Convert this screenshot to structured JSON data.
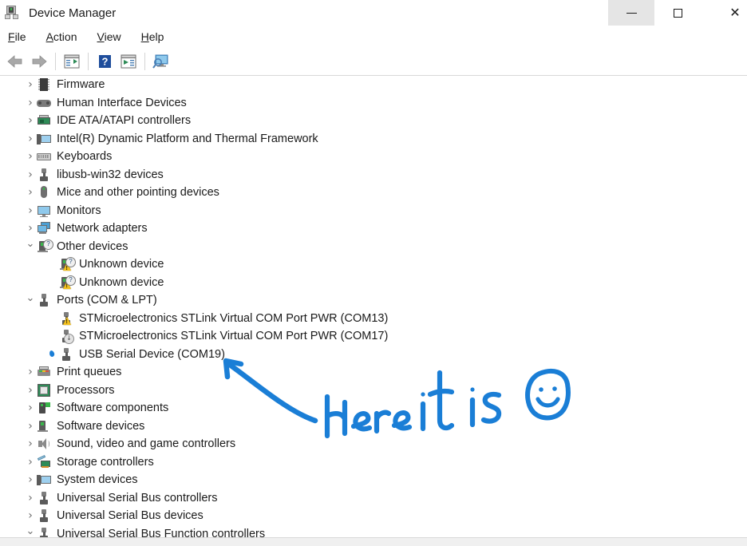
{
  "window": {
    "title": "Device Manager",
    "title_icon": "device-manager-icon",
    "caption": {
      "minimize_label": "—",
      "minimize_icon": "minimize-icon",
      "minimize_hover": true,
      "maximize_label": "☐",
      "maximize_icon": "maximize-icon",
      "close_label": "✕",
      "close_icon": "close-icon"
    }
  },
  "menubar": {
    "items": [
      {
        "label": "File",
        "accesskey": "F",
        "rest": "ile"
      },
      {
        "label": "Action",
        "accesskey": "A",
        "rest": "ction"
      },
      {
        "label": "View",
        "accesskey": "V",
        "rest": "iew"
      },
      {
        "label": "Help",
        "accesskey": "H",
        "rest": "elp"
      }
    ]
  },
  "toolbar": {
    "buttons": [
      {
        "name": "back-button",
        "icon": "back-arrow-icon",
        "label": "Back"
      },
      {
        "name": "forward-button",
        "icon": "forward-arrow-icon",
        "label": "Forward"
      },
      {
        "name": "properties-button",
        "icon": "properties-window-icon",
        "label": "Properties"
      },
      {
        "name": "help-button",
        "icon": "question-mark-icon",
        "label": "Help"
      },
      {
        "name": "update-driver-button",
        "icon": "window-play-icon",
        "label": "Update driver"
      },
      {
        "name": "scan-hardware-button",
        "icon": "scan-hardware-icon",
        "label": "Scan for hardware changes"
      }
    ]
  },
  "tree": {
    "rows": [
      {
        "label": "Firmware",
        "indent": 0,
        "state": "collapsed",
        "icon": "firmware-chip-icon",
        "badge": "none"
      },
      {
        "label": "Human Interface Devices",
        "indent": 0,
        "state": "collapsed",
        "icon": "gamepad-icon",
        "badge": "none"
      },
      {
        "label": "IDE ATA/ATAPI controllers",
        "indent": 0,
        "state": "collapsed",
        "icon": "ide-controller-card-icon",
        "badge": "none"
      },
      {
        "label": "Intel(R) Dynamic Platform and Thermal Framework",
        "indent": 0,
        "state": "collapsed",
        "icon": "system-device-icon",
        "badge": "none"
      },
      {
        "label": "Keyboards",
        "indent": 0,
        "state": "collapsed",
        "icon": "keyboard-icon",
        "badge": "none"
      },
      {
        "label": "libusb-win32 devices",
        "indent": 0,
        "state": "collapsed",
        "icon": "usb-plug-icon",
        "badge": "none"
      },
      {
        "label": "Mice and other pointing devices",
        "indent": 0,
        "state": "collapsed",
        "icon": "mouse-icon",
        "badge": "none"
      },
      {
        "label": "Monitors",
        "indent": 0,
        "state": "collapsed",
        "icon": "monitor-icon",
        "badge": "none"
      },
      {
        "label": "Network adapters",
        "indent": 0,
        "state": "collapsed",
        "icon": "network-adapter-icon",
        "badge": "none"
      },
      {
        "label": "Other devices",
        "indent": 0,
        "state": "expanded",
        "icon": "unknown-device-icon",
        "badge": "question"
      },
      {
        "label": "Unknown device",
        "indent": 1,
        "state": "leaf",
        "icon": "unknown-device-icon",
        "badge": "question-warning"
      },
      {
        "label": "Unknown device",
        "indent": 1,
        "state": "leaf",
        "icon": "unknown-device-icon",
        "badge": "question-warning"
      },
      {
        "label": "Ports (COM & LPT)",
        "indent": 0,
        "state": "expanded",
        "icon": "serial-port-icon",
        "badge": "none"
      },
      {
        "label": "STMicroelectronics STLink Virtual COM Port PWR (COM13)",
        "indent": 1,
        "state": "leaf",
        "icon": "serial-port-icon",
        "badge": "warning"
      },
      {
        "label": "STMicroelectronics STLink Virtual COM Port PWR (COM17)",
        "indent": 1,
        "state": "leaf",
        "icon": "serial-port-icon",
        "badge": "disabled"
      },
      {
        "label": "USB Serial Device (COM19)",
        "indent": 1,
        "state": "leaf",
        "icon": "serial-port-icon",
        "badge": "none",
        "marker": "blue-dot"
      },
      {
        "label": "Print queues",
        "indent": 0,
        "state": "collapsed",
        "icon": "printer-icon",
        "badge": "none"
      },
      {
        "label": "Processors",
        "indent": 0,
        "state": "collapsed",
        "icon": "processor-icon",
        "badge": "none"
      },
      {
        "label": "Software components",
        "indent": 0,
        "state": "collapsed",
        "icon": "software-component-icon",
        "badge": "none"
      },
      {
        "label": "Software devices",
        "indent": 0,
        "state": "collapsed",
        "icon": "software-device-icon",
        "badge": "none"
      },
      {
        "label": "Sound, video and game controllers",
        "indent": 0,
        "state": "collapsed",
        "icon": "speaker-icon",
        "badge": "none"
      },
      {
        "label": "Storage controllers",
        "indent": 0,
        "state": "collapsed",
        "icon": "storage-controller-icon",
        "badge": "none"
      },
      {
        "label": "System devices",
        "indent": 0,
        "state": "collapsed",
        "icon": "system-device-icon",
        "badge": "none"
      },
      {
        "label": "Universal Serial Bus controllers",
        "indent": 0,
        "state": "collapsed",
        "icon": "usb-plug-icon",
        "badge": "none"
      },
      {
        "label": "Universal Serial Bus devices",
        "indent": 0,
        "state": "collapsed",
        "icon": "usb-plug-icon",
        "badge": "none"
      },
      {
        "label": "Universal Serial Bus Function controllers",
        "indent": 0,
        "state": "expanded",
        "icon": "usb-function-icon",
        "badge": "none"
      }
    ],
    "chevron_collapsed": "›",
    "chevron_expanded": "⌄"
  },
  "annotation": {
    "text": "Here it is",
    "color": "#1a7ed6",
    "arrow": "arrow-pointing-to-usb-serial-device",
    "face": "smiley-face"
  },
  "colors": {
    "accent_blue": "#1a7ed6",
    "window_bg": "#ffffff",
    "text": "#1a1a1a",
    "chevron": "#6d6d6d",
    "warning_yellow": "#f2c01e",
    "status_bar": "#f0f0f0",
    "caption_hover": "#e5e5e5"
  }
}
